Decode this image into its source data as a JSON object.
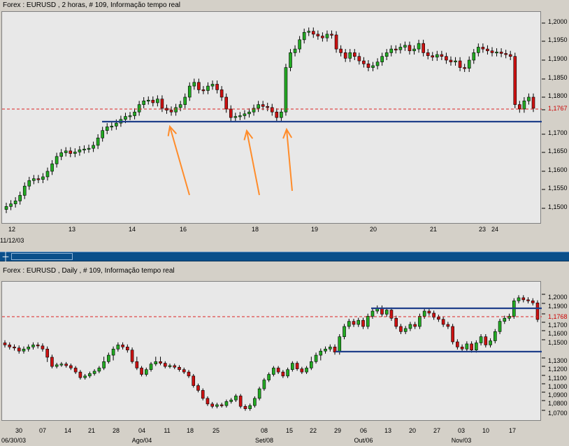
{
  "top_chart": {
    "caption": "Forex : EURUSD , 2 horas, # 109, Informação tempo real",
    "y_ticks": [
      "1,2000",
      "1,1950",
      "1,1900",
      "1,1850",
      "1,1800",
      "1,1767",
      "1,1700",
      "1,1650",
      "1,1600",
      "1,1550",
      "1,1500"
    ],
    "x_ticks": [
      "12",
      "13",
      "14",
      "16",
      "18",
      "19",
      "20",
      "21",
      "23",
      "24"
    ],
    "date_label": "11/12/03",
    "current_price_label": "1,1767"
  },
  "bottom_chart": {
    "caption": "Forex : EURUSD , Daily , # 109, Informação tempo real",
    "y_ticks": [
      "1,2000",
      "1,1900",
      "1,1768",
      "1,1700",
      "1,1600",
      "1,1500",
      "1,1300",
      "1,1200",
      "1,1100",
      "1,1000",
      "1,0900",
      "1,0800",
      "1,0700"
    ],
    "x_ticks": [
      "30",
      "07",
      "14",
      "21",
      "28",
      "04",
      "11",
      "18",
      "25",
      "08",
      "15",
      "22",
      "29",
      "06",
      "13",
      "20",
      "27",
      "03",
      "10",
      "17"
    ],
    "month_labels": [
      "06/30/03",
      "Ago/04",
      "Set/08",
      "Out/06",
      "Nov/03"
    ],
    "current_price_label": "1,1768"
  },
  "colors": {
    "bull": "#22aa22",
    "bear": "#cc1111",
    "support": "#1f3f8a",
    "arrow": "#ff8c2a",
    "price_line": "#dd2222"
  },
  "icons": {
    "split_handle": "split-handle-icon"
  }
}
